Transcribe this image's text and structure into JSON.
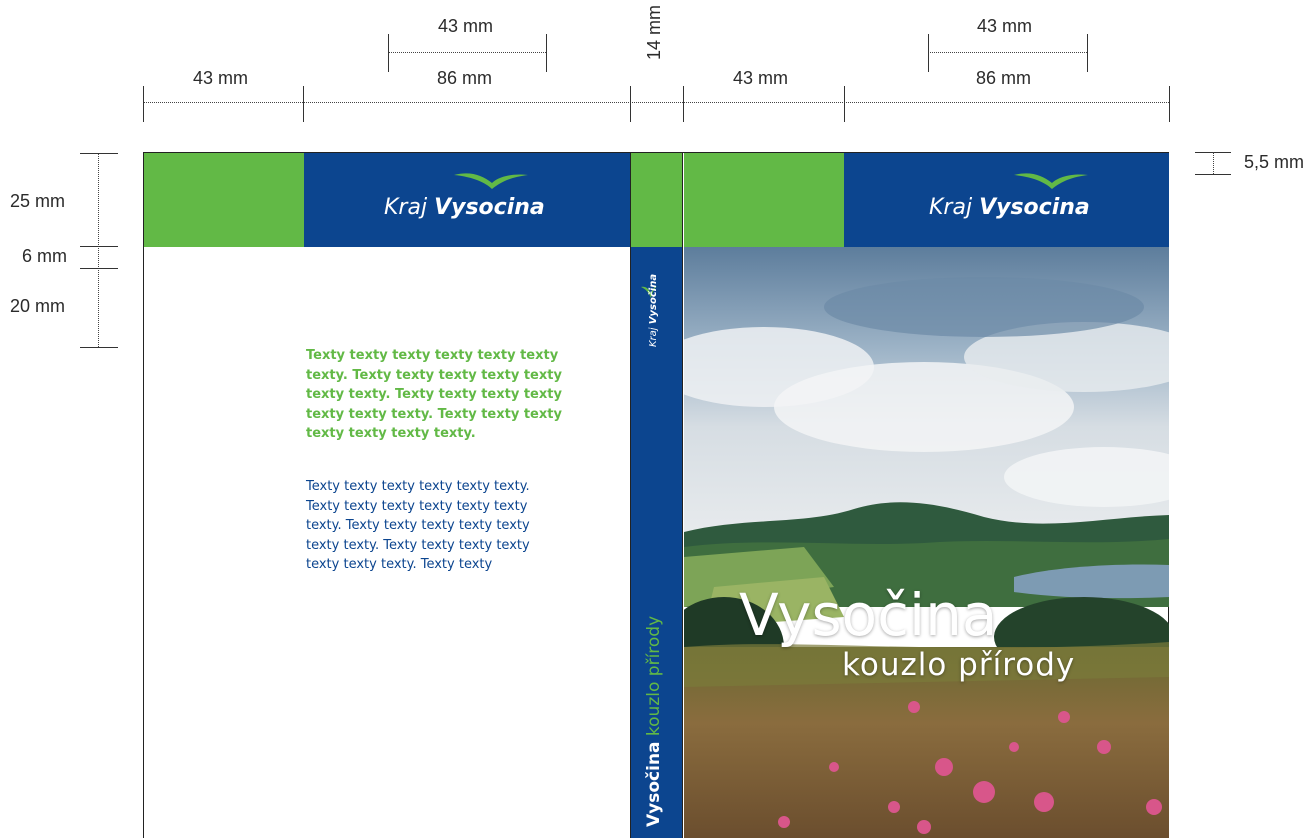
{
  "dimensions": {
    "top_row_lower": [
      "43 mm",
      "86 mm",
      "43 mm",
      "86 mm"
    ],
    "top_row_upper": [
      "43 mm",
      "43 mm"
    ],
    "spine": "14 mm",
    "left_side": [
      "25 mm",
      "6 mm",
      "20 mm"
    ],
    "bleed": "5,5 mm"
  },
  "logo": {
    "prefix": "Kraj",
    "name": "Vysocina"
  },
  "back_cover": {
    "green_paragraph": "Texty texty texty texty texty texty texty. Texty texty texty texty texty texty texty. Texty texty texty texty texty texty texty. Texty texty texty texty texty texty texty.",
    "blue_paragraph": "Texty texty texty texty texty texty. Texty texty texty texty texty texty texty. Texty texty texty texty texty texty texty. Texty texty texty texty texty texty texty. Texty texty"
  },
  "spine": {
    "logo_prefix": "Kraj",
    "logo_name": "Vysočina",
    "title_bold": "Vysočina",
    "title_light": "kouzlo přírody"
  },
  "front_cover": {
    "title": "Vysočina",
    "subtitle": "kouzlo přírody"
  },
  "colors": {
    "green": "#62b946",
    "blue": "#0c458f"
  }
}
